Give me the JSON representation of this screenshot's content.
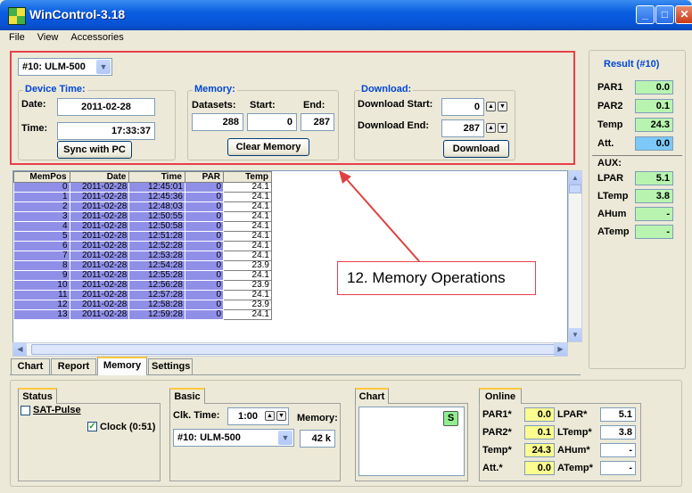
{
  "window": {
    "title": "WinControl-3.18",
    "buttons": [
      "_",
      "□",
      "✕"
    ]
  },
  "menu": [
    "File",
    "View",
    "Accessories"
  ],
  "device": {
    "selected": "#10: ULM-500"
  },
  "device_time": {
    "title": "Device Time:",
    "date_label": "Date:",
    "date": "2011-02-28",
    "time_label": "Time:",
    "time": "17:33:37",
    "sync_label": "Sync with PC"
  },
  "memory": {
    "title": "Memory:",
    "datasets_label": "Datasets:",
    "start_label": "Start:",
    "end_label": "End:",
    "datasets": "288",
    "start": "0",
    "end": "287",
    "clear_label": "Clear Memory"
  },
  "download": {
    "title": "Download:",
    "start_label": "Download Start:",
    "end_label": "Download End:",
    "start": "0",
    "end": "287",
    "button_label": "Download"
  },
  "table": {
    "headers": [
      "MemPos",
      "Date",
      "Time",
      "PAR",
      "Temp"
    ],
    "rows": [
      [
        "0",
        "2011-02-28",
        "12:45:01",
        "0",
        "24.1"
      ],
      [
        "1",
        "2011-02-28",
        "12:45:36",
        "0",
        "24.1"
      ],
      [
        "2",
        "2011-02-28",
        "12:48:03",
        "0",
        "24.1"
      ],
      [
        "3",
        "2011-02-28",
        "12:50:55",
        "0",
        "24.1"
      ],
      [
        "4",
        "2011-02-28",
        "12:50:58",
        "0",
        "24.1"
      ],
      [
        "5",
        "2011-02-28",
        "12:51:28",
        "0",
        "24.1"
      ],
      [
        "6",
        "2011-02-28",
        "12:52:28",
        "0",
        "24.1"
      ],
      [
        "7",
        "2011-02-28",
        "12:53:28",
        "0",
        "24.1"
      ],
      [
        "8",
        "2011-02-28",
        "12:54:28",
        "0",
        "23.9"
      ],
      [
        "9",
        "2011-02-28",
        "12:55:28",
        "0",
        "24.1"
      ],
      [
        "10",
        "2011-02-28",
        "12:56:28",
        "0",
        "23.9"
      ],
      [
        "11",
        "2011-02-28",
        "12:57:28",
        "0",
        "24.1"
      ],
      [
        "12",
        "2011-02-28",
        "12:58:28",
        "0",
        "23.9"
      ],
      [
        "13",
        "2011-02-28",
        "12:59:28",
        "0",
        "24.1"
      ]
    ]
  },
  "annotation": "12. Memory Operations",
  "tabs": [
    "Chart",
    "Report",
    "Memory",
    "Settings"
  ],
  "active_tab": "Memory",
  "result": {
    "title": "Result (#10)",
    "items": [
      {
        "label": "PAR1",
        "value": "0.0"
      },
      {
        "label": "PAR2",
        "value": "0.1"
      },
      {
        "label": "Temp",
        "value": "24.3"
      },
      {
        "label": "Att.",
        "value": "0.0"
      }
    ],
    "aux_label": "AUX:",
    "aux": [
      {
        "label": "LPAR",
        "value": "5.1"
      },
      {
        "label": "LTemp",
        "value": "3.8"
      },
      {
        "label": "AHum",
        "value": "-"
      },
      {
        "label": "ATemp",
        "value": "-"
      }
    ]
  },
  "status": {
    "tab": "Status",
    "sat_pulse_label": "SAT-Pulse",
    "clock_label": "Clock (0:51)"
  },
  "basic": {
    "tab": "Basic",
    "clk_time_label": "Clk. Time:",
    "clk_time": "1:00",
    "memory_label": "Memory:",
    "memory_value": "42 k",
    "device": "#10: ULM-500"
  },
  "chart_panel": {
    "tab": "Chart",
    "s_button": "S"
  },
  "online": {
    "tab": "Online",
    "left": [
      {
        "label": "PAR1*",
        "value": "0.0"
      },
      {
        "label": "PAR2*",
        "value": "0.1"
      },
      {
        "label": "Temp*",
        "value": "24.3"
      },
      {
        "label": "Att.*",
        "value": "0.0"
      }
    ],
    "right": [
      {
        "label": "LPAR*",
        "value": "5.1"
      },
      {
        "label": "LTemp*",
        "value": "3.8"
      },
      {
        "label": "AHum*",
        "value": "-"
      },
      {
        "label": "ATemp*",
        "value": "-"
      }
    ]
  },
  "colors": {
    "title_blue": "#0a5ee0",
    "group_title": "#0046d5",
    "row_blue": "#8f8fe8",
    "highlight_red": "#e8404a",
    "value_green": "#b8f4b0",
    "value_blue": "#7cc8f8",
    "value_yellow": "#fcfc90"
  }
}
